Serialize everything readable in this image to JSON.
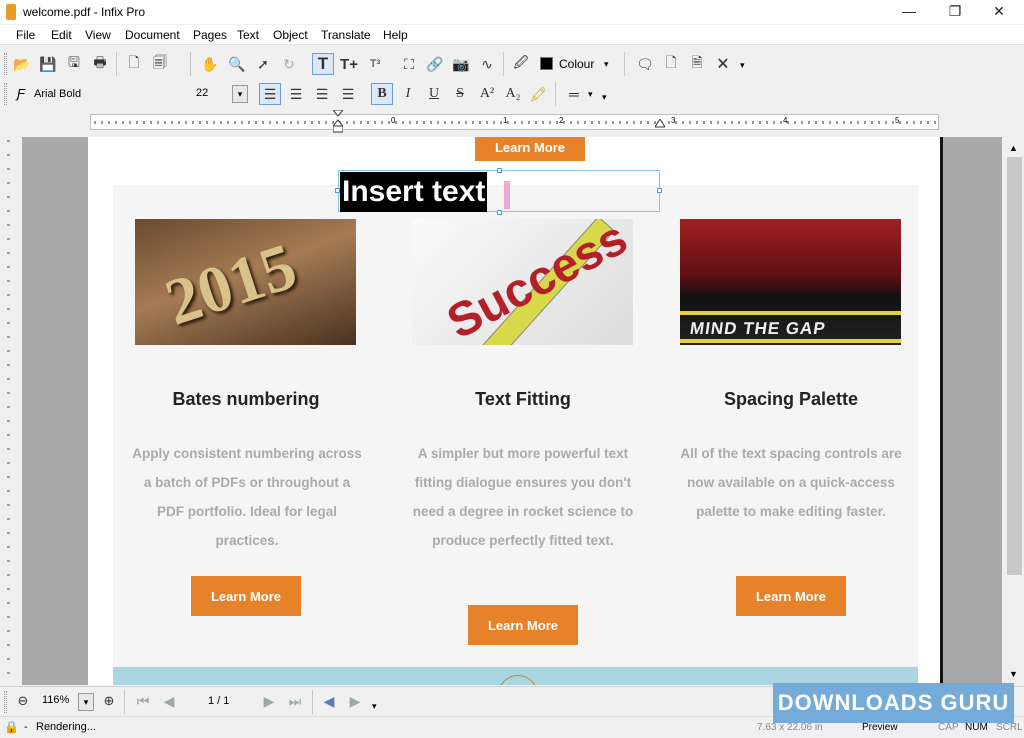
{
  "window": {
    "title": "welcome.pdf - Infix Pro",
    "minimize": "—",
    "maximize": "❐",
    "close": "✕"
  },
  "menu": [
    "File",
    "Edit",
    "View",
    "Document",
    "Pages",
    "Text",
    "Object",
    "Translate",
    "Help"
  ],
  "toolbar1": {
    "colour_label": "Colour"
  },
  "toolbar2": {
    "font_name": "Arial Bold",
    "font_size": "22"
  },
  "document": {
    "top_button": "Learn More",
    "insert_text": "Insert text",
    "cards": [
      {
        "heading": "Bates numbering",
        "body": "Apply consistent numbering across a batch of PDFs or throughout a PDF portfolio. Ideal for legal practices.",
        "button": "Learn More",
        "image_text": "2015"
      },
      {
        "heading": "Text Fitting",
        "body": "A simpler but more powerful text fitting dialogue ensures you don't need a degree in rocket science to produce perfectly fitted text.",
        "button": "Learn More",
        "image_text": "Success"
      },
      {
        "heading": "Spacing Palette",
        "body": "All of the text spacing controls are now available on a quick-access palette to make editing faster.",
        "button": "Learn More",
        "image_text": "MIND THE GAP"
      }
    ]
  },
  "ruler_numbers": [
    "0",
    "1",
    "2",
    "3",
    "4",
    "5"
  ],
  "nav": {
    "zoom": "116%",
    "page": "1 / 1"
  },
  "status": {
    "text": "Rendering...",
    "dimensions": "7.63 x 22.06 in",
    "mode": "Preview",
    "cap": "CAP",
    "num": "NUM",
    "scrl": "SCRL"
  },
  "watermark": "DOWNLOADS GURU",
  "colors": {
    "accent": "#e6822a",
    "panel": "#f5f5f5",
    "band": "#a9d6e0"
  }
}
